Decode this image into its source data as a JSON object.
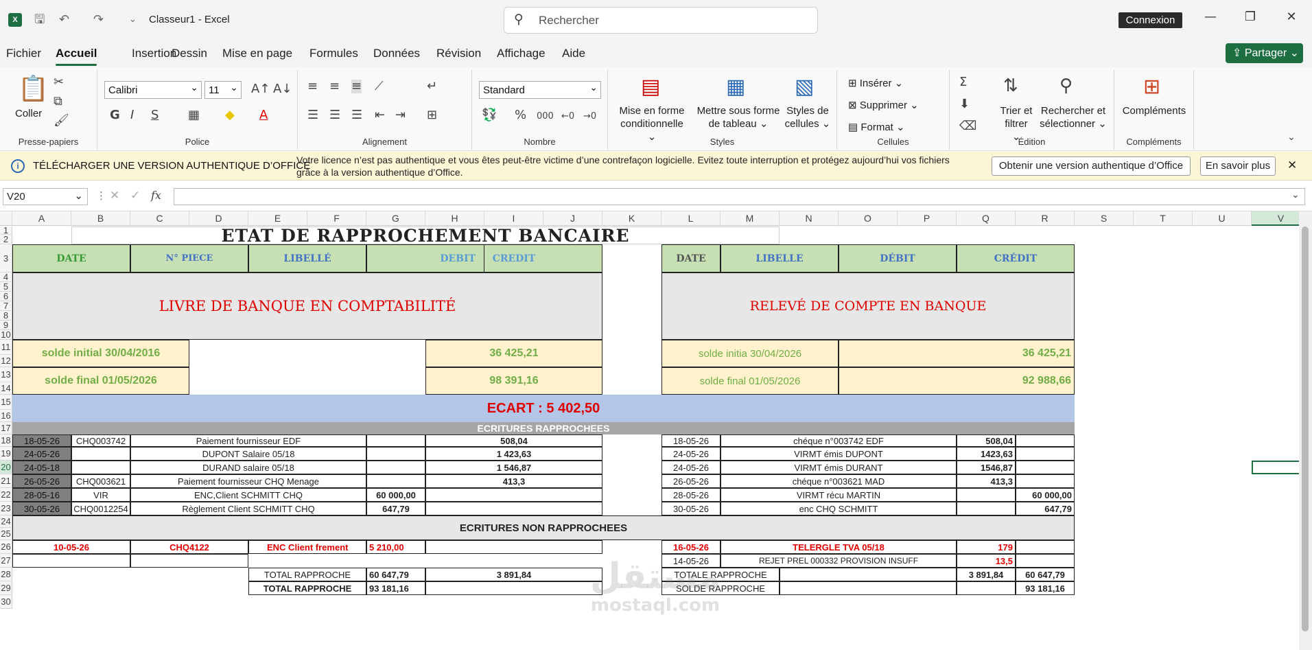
{
  "app": {
    "title": "Classeur1  -  Excel",
    "search_placeholder": "Rechercher",
    "signin": "Connexion",
    "logo": "X"
  },
  "menu": {
    "tabs": [
      "Fichier",
      "Accueil",
      "Insertion",
      "Dessin",
      "Mise en page",
      "Formules",
      "Données",
      "Révision",
      "Affichage",
      "Aide"
    ],
    "share": "Partager"
  },
  "ribbon": {
    "paste": "Coller",
    "clipboard": "Presse-papiers",
    "font": "Calibri",
    "size": "11",
    "font_group": "Police",
    "align_group": "Alignement",
    "numfmt": "Standard",
    "number_group": "Nombre",
    "cond1": "Mise en forme",
    "cond2": "conditionnelle",
    "table1": "Mettre sous forme",
    "table2": "de tableau",
    "styles1": "Styles de",
    "styles2": "cellules",
    "styles_group": "Styles",
    "insert": "Insérer",
    "delete": "Supprimer",
    "format": "Format",
    "cells_group": "Cellules",
    "sort1": "Trier et",
    "sort2": "filtrer",
    "find1": "Rechercher et",
    "find2": "sélectionner",
    "edit_group": "Édition",
    "addins": "Compléments",
    "addins_group": "Compléments"
  },
  "notice": {
    "heading": "TÉLÉCHARGER UNE VERSION AUTHENTIQUE D’OFFICE",
    "message": "Votre licence n’est pas authentique et vous êtes peut-être victime d’une contrefaçon logicielle. Evitez toute interruption et protégez aujourd’hui vos fichiers grâce à la version authentique d’Office.",
    "btn_get": "Obtenir une version authentique d’Office",
    "btn_more": "En savoir plus"
  },
  "formula_bar": {
    "name_box": "V20",
    "formula": ""
  },
  "columns": [
    "A",
    "B",
    "C",
    "D",
    "E",
    "F",
    "G",
    "H",
    "I",
    "J",
    "K",
    "L",
    "M",
    "N",
    "O",
    "P",
    "Q",
    "R",
    "S",
    "T",
    "U",
    "V"
  ],
  "rows": [
    "1",
    "2",
    "3",
    "4",
    "5",
    "6",
    "7",
    "8",
    "9",
    "10",
    "11",
    "12",
    "13",
    "14",
    "15",
    "16",
    "17",
    "18",
    "19",
    "20",
    "21",
    "22",
    "23",
    "24",
    "25",
    "26",
    "27",
    "28",
    "29",
    "30"
  ],
  "sheet": {
    "title": "ETAT DE RAPPROCHEMENT BANCAIRE",
    "left_hdr": {
      "date": "DATE",
      "piece": "N° PIECE",
      "libelle": "LIBELLÉ",
      "debit": "DEBIT",
      "credit": "CREDIT"
    },
    "right_hdr": {
      "date": "DATE",
      "libelle": "LIBELLE",
      "debit": "DÉBIT",
      "credit": "CRÉDIT"
    },
    "left_section": "LIVRE DE BANQUE EN COMPTABILITÉ",
    "right_section": "RELEVÉ DE COMPTE EN BANQUE",
    "l_init_label": "solde initial 30/04/2016",
    "l_init_val": "36 425,21",
    "l_final_label": "solde final 01/05/2026",
    "l_final_val": "98 391,16",
    "r_init_label": "solde initia 30/04/2026",
    "r_init_val": "36 425,21",
    "r_final_label": "solde final 01/05/2026",
    "r_final_val": "92 988,66",
    "ecart": "ECART : 5 402,50",
    "rapp_title": "ECRITURES RAPPROCHEES",
    "left_rows": [
      [
        "18-05-26",
        "CHQ003742",
        "Paiement fournisseur EDF",
        "",
        "508,04"
      ],
      [
        "24-05-26",
        "",
        "DUPONT Salaire 05/18",
        "",
        "1 423,63"
      ],
      [
        "24-05-18",
        "",
        "DURAND salaire 05/18",
        "",
        "1 546,87"
      ],
      [
        "26-05-26",
        "CHQ003621",
        "Paiement fournisseur CHQ Menage",
        "",
        "413,3"
      ],
      [
        "28-05-16",
        "VIR",
        "ENC,Client SCHMITT CHQ",
        "60 000,00",
        ""
      ],
      [
        "30-05-26",
        "CHQ0012254",
        "Règlement Client SCHMITT CHQ",
        "647,79",
        ""
      ]
    ],
    "right_rows": [
      [
        "18-05-26",
        "chéque n°003742 EDF",
        "508,04",
        ""
      ],
      [
        "24-05-26",
        "VIRMT émis DUPONT",
        "1423,63",
        ""
      ],
      [
        "24-05-26",
        "VIRMT émis DURANT",
        "1546,87",
        ""
      ],
      [
        "26-05-26",
        "chéque n°003621 MAD",
        "413,3",
        ""
      ],
      [
        "28-05-26",
        "VIRMT récu MARTIN",
        "",
        "60 000,00"
      ],
      [
        "30-05-26",
        "enc CHQ SCHMITT",
        "",
        "647,79"
      ]
    ],
    "nonrapp_title": "ECRITURES NON RAPPROCHEES",
    "nr_l": {
      "date": "10-05-26",
      "piece": "CHQ4122",
      "lib": "ENC Client frement",
      "debit": "5 210,00"
    },
    "nr_r1": {
      "date": "16-05-26",
      "lib": "TELERGLE TVA 05/18",
      "debit": "179"
    },
    "nr_r2": {
      "date": "14-05-26",
      "lib": "REJET PREL 000332 PROVISION INSUFF",
      "debit": "13,5"
    },
    "tot_l1": {
      "label": "TOTAL RAPPROCHE",
      "debit": "60 647,79",
      "credit": "3 891,84"
    },
    "tot_l2": {
      "label": "TOTAL RAPPROCHE",
      "debit": "93 181,16"
    },
    "tot_r1": {
      "label": "TOTALE RAPPROCHE",
      "debit": "3 891,84",
      "credit": "60 647,79"
    },
    "tot_r2": {
      "label": "SOLDE RAPPROCHE",
      "credit": "93 181,16"
    }
  },
  "watermark": {
    "ar": "مستقل",
    "latin": "mostaql.com"
  },
  "colors": {
    "excel_green": "#1d6f42",
    "red": "#e00000",
    "olive": "#70ad47",
    "blue": "#4472c4"
  }
}
